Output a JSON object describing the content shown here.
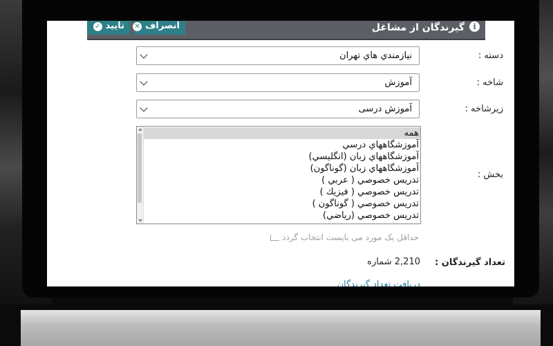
{
  "header": {
    "title": "گيرندگان از مشاغل",
    "info_icon": "i",
    "confirm_label": "تایید",
    "confirm_icon": "✓",
    "cancel_label": "انصراف",
    "cancel_icon": "✕"
  },
  "form": {
    "category": {
      "label": "دسته :",
      "value": "نيازمندي هاي تهران"
    },
    "branch": {
      "label": "شاخه :",
      "value": "آموزش"
    },
    "subbranch": {
      "label": "زیرشاخه :",
      "value": "آموزش درسی"
    },
    "section": {
      "label": "بخش :",
      "options": [
        {
          "label": "همه",
          "selected": true
        },
        {
          "label": "آموزشگاههاي درسي",
          "selected": false
        },
        {
          "label": "آموزشگاههاي زبان (انگليسي)",
          "selected": false
        },
        {
          "label": "آموزشگاههاي زبان (گوناگون)",
          "selected": false
        },
        {
          "label": "تدريس خصوصي ( عربي )",
          "selected": false
        },
        {
          "label": "تدريس خصوصي ( فيزيك )",
          "selected": false
        },
        {
          "label": "تدريس خصوصي ( گوناگون )",
          "selected": false
        },
        {
          "label": "تدريس خصوصي (رياضي)",
          "selected": false
        }
      ]
    },
    "hint": "حداقل یک مورد می بایست انتخاب گردد"
  },
  "recipients": {
    "label": "تعداد گیرندگان :",
    "count": "2,210",
    "unit": "شماره"
  },
  "link_label": "دريافت تعداد گيرندگان"
}
